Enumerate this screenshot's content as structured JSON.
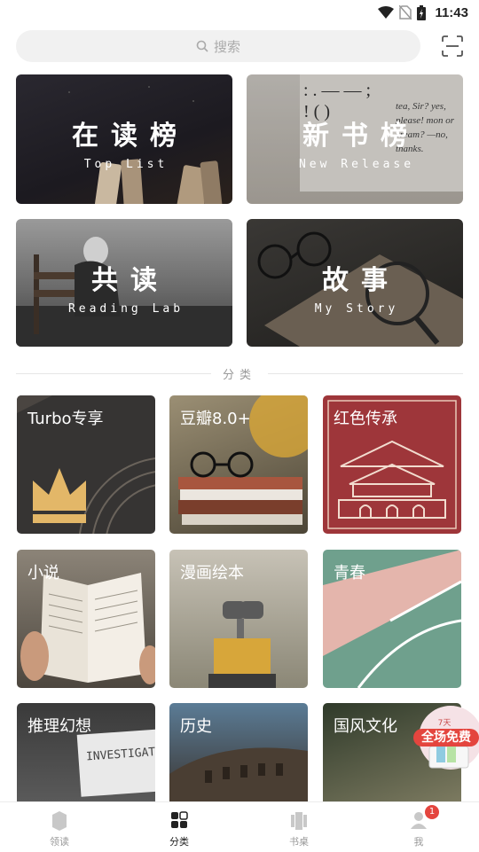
{
  "status_bar": {
    "time": "11:43"
  },
  "search": {
    "placeholder": "搜索"
  },
  "featured": [
    {
      "title": "在读榜",
      "subtitle": "Top List"
    },
    {
      "title": "新书榜",
      "subtitle": "New Release"
    },
    {
      "title": "共读",
      "subtitle": "Reading Lab"
    },
    {
      "title": "故事",
      "subtitle": "My Story"
    }
  ],
  "new_release_art": {
    "punct": ": . — — ; ! ( )",
    "quote": "tea, Sir? yes, please! mon or cream? —no, thanks."
  },
  "section_title": "分类",
  "categories": [
    {
      "label": "Turbo专享"
    },
    {
      "label": "豆瓣8.0+"
    },
    {
      "label": "红色传承"
    },
    {
      "label": "小说"
    },
    {
      "label": "漫画绘本"
    },
    {
      "label": "青春"
    },
    {
      "label": "推理幻想"
    },
    {
      "label": "历史"
    },
    {
      "label": "国风文化"
    }
  ],
  "book_cover_text": "INVESTIGATION",
  "promo": {
    "top": "7天",
    "main": "全场免费"
  },
  "tabs": [
    {
      "label": "领读",
      "icon": "book-icon"
    },
    {
      "label": "分类",
      "icon": "category-icon"
    },
    {
      "label": "书桌",
      "icon": "desk-icon"
    },
    {
      "label": "我",
      "icon": "profile-icon",
      "badge": "1"
    }
  ]
}
